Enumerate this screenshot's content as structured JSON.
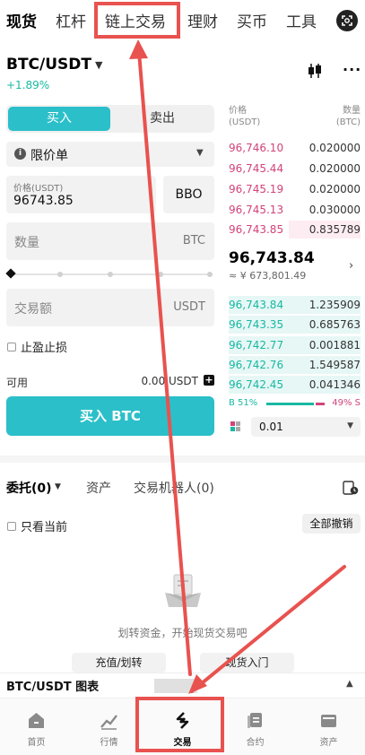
{
  "top_tabs": [
    {
      "label": "现货",
      "active": true
    },
    {
      "label": "杠杆",
      "active": false
    },
    {
      "label": "链上交易",
      "active": false
    },
    {
      "label": "理财",
      "active": false
    },
    {
      "label": "买币",
      "active": false
    },
    {
      "label": "工具",
      "active": false
    }
  ],
  "pair": {
    "name": "BTC/USDT",
    "change": "+1.89%"
  },
  "trade": {
    "buy_label": "买入",
    "sell_label": "卖出",
    "order_type": "限价单",
    "price_caption": "价格(USDT)",
    "price_value": "96743.85",
    "bbo_label": "BBO",
    "qty_placeholder": "数量",
    "qty_unit": "BTC",
    "amount_placeholder": "交易额",
    "amount_unit": "USDT",
    "tpsl_label": "止盈止损",
    "available_label": "可用",
    "available_value": "0.00 USDT",
    "buy_button": "买入 BTC"
  },
  "orderbook": {
    "price_header": "价格\n(USDT)",
    "qty_header": "数量\n(BTC)",
    "asks": [
      {
        "price": "96,746.10",
        "qty": "0.020000"
      },
      {
        "price": "96,745.44",
        "qty": "0.020000"
      },
      {
        "price": "96,745.19",
        "qty": "0.020000"
      },
      {
        "price": "96,745.13",
        "qty": "0.030000"
      },
      {
        "price": "96,743.85",
        "qty": "0.835789"
      }
    ],
    "mid_price": "96,743.84",
    "mid_fiat": "≈ ¥ 673,801.49",
    "bids": [
      {
        "price": "96,743.84",
        "qty": "1.235909"
      },
      {
        "price": "96,743.35",
        "qty": "0.685763"
      },
      {
        "price": "96,742.77",
        "qty": "0.001881"
      },
      {
        "price": "96,742.76",
        "qty": "1.549587"
      },
      {
        "price": "96,742.45",
        "qty": "0.041346"
      }
    ],
    "buy_ratio_label": "B 51%",
    "sell_ratio_label": "49% S",
    "depth_value": "0.01"
  },
  "orders": {
    "tabs": [
      {
        "label": "委托(0)",
        "active": true
      },
      {
        "label": "资产",
        "active": false
      },
      {
        "label": "交易机器人(0)",
        "active": false
      }
    ],
    "only_current_label": "只看当前",
    "cancel_all_label": "全部撤销",
    "empty_text": "划转资金，开始现货交易吧",
    "empty_buttons": [
      "充值/划转",
      "现货入门"
    ]
  },
  "chart_bar_label": "BTC/USDT 图表",
  "bottom_nav": [
    {
      "label": "首页",
      "icon": "home-icon",
      "active": false
    },
    {
      "label": "行情",
      "icon": "market-icon",
      "active": false
    },
    {
      "label": "交易",
      "icon": "trade-icon",
      "active": true
    },
    {
      "label": "合约",
      "icon": "contract-icon",
      "active": false
    },
    {
      "label": "资产",
      "icon": "wallet-icon",
      "active": false
    }
  ],
  "colors": {
    "accent": "#2bbfc9",
    "ask": "#d2437a",
    "bid": "#19b8a3",
    "annotation": "#e8524f"
  }
}
